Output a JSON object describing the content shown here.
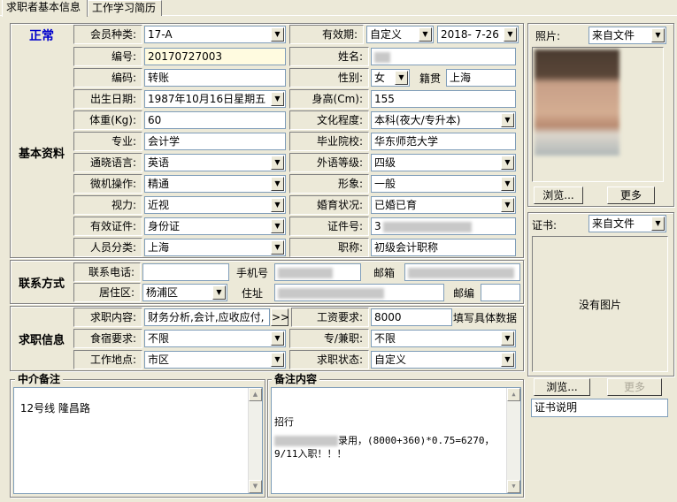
{
  "tabs": [
    "求职者基本信息",
    "工作学习简历"
  ],
  "status": "正常",
  "member_type": {
    "label": "会员种类:",
    "value": "17-A"
  },
  "validity": {
    "label": "有效期:",
    "mode": "自定义",
    "date": "2018- 7-26"
  },
  "sections": {
    "basic": "基本资料",
    "contact": "联系方式",
    "job": "求职信息",
    "agency_note": "中介备注",
    "remark": "备注内容"
  },
  "basic": {
    "number": {
      "label": "编号:",
      "value": "20170727003"
    },
    "name": {
      "label": "姓名:"
    },
    "code": {
      "label": "编码:",
      "value": "转账"
    },
    "gender": {
      "label": "性别:",
      "value": "女"
    },
    "origin": {
      "label": "籍贯",
      "value": "上海"
    },
    "birth": {
      "label": "出生日期:",
      "value": "1987年10月16日星期五"
    },
    "height": {
      "label": "身高(Cm):",
      "value": "155"
    },
    "weight": {
      "label": "体重(Kg):",
      "value": "60"
    },
    "education": {
      "label": "文化程度:",
      "value": "本科(夜大/专升本)"
    },
    "major": {
      "label": "专业:",
      "value": "会计学"
    },
    "school": {
      "label": "毕业院校:",
      "value": "华东师范大学"
    },
    "language": {
      "label": "通晓语言:",
      "value": "英语"
    },
    "lang_level": {
      "label": "外语等级:",
      "value": "四级"
    },
    "computer": {
      "label": "微机操作:",
      "value": "精通"
    },
    "appearance": {
      "label": "形象:",
      "value": "一般"
    },
    "vision": {
      "label": "视力:",
      "value": "近视"
    },
    "marital": {
      "label": "婚育状况:",
      "value": "已婚已育"
    },
    "id_type": {
      "label": "有效证件:",
      "value": "身份证"
    },
    "id_no": {
      "label": "证件号:",
      "value": "3"
    },
    "category": {
      "label": "人员分类:",
      "value": "上海"
    },
    "title": {
      "label": "职称:",
      "value": "初级会计职称"
    }
  },
  "contact": {
    "tel_label": "联系电话:",
    "mobile_label": "手机号",
    "email_label": "邮箱",
    "district_label": "居住区:",
    "district": "杨浦区",
    "address_label": "住址",
    "zip_label": "邮编"
  },
  "job": {
    "content_label": "求职内容:",
    "content": "财务分析,会计,应收应付,",
    "more": ">>",
    "salary_label": "工资要求:",
    "salary": "8000",
    "salary_hint": "填写具体数据",
    "board_label": "食宿要求:",
    "board": "不限",
    "type_label": "专/兼职:",
    "type": "不限",
    "place_label": "工作地点:",
    "place": "市区",
    "state_label": "求职状态:",
    "state": "自定义"
  },
  "agency_note": "12号线 隆昌路",
  "remark": {
    "line1": "招行",
    "line2": "录用，(8000+360)*0.75=6270，",
    "line3": "9/11入职！！！"
  },
  "photo": {
    "label": "照片:",
    "source": "来自文件",
    "browse": "浏览...",
    "more": "更多"
  },
  "cert": {
    "label": "证书:",
    "source": "来自文件",
    "no_image": "没有图片",
    "browse": "浏览...",
    "more": "更多",
    "desc": "证书说明"
  }
}
